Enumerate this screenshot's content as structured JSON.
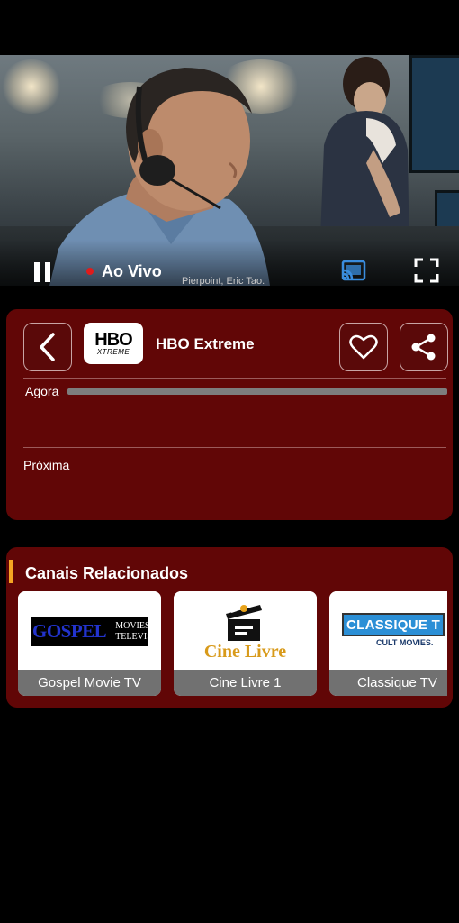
{
  "player": {
    "live_label": "Ao Vivo",
    "subtitle": "Pierpoint, Eric Tao.",
    "icons": {
      "pause": "pause-icon",
      "cast": "cast-icon",
      "fullscreen": "fullscreen-icon"
    },
    "live_color": "#e01b1b"
  },
  "channel": {
    "logo_main": "HBO",
    "logo_sub": "XTREME",
    "name": "HBO Extreme",
    "now_label": "Agora",
    "next_label": "Próxima",
    "icons": {
      "back": "chevron-left-icon",
      "favorite": "heart-icon",
      "share": "share-icon"
    },
    "panel_color": "#610606"
  },
  "related": {
    "title": "Canais Relacionados",
    "accent_color": "#f5a623",
    "items": [
      {
        "name": "Gospel Movie TV",
        "logo_a": "GOSPEL",
        "logo_b": "MOVIES",
        "logo_c": "TELEVISION"
      },
      {
        "name": "Cine Livre 1",
        "logo_a": "Cine Livre"
      },
      {
        "name": "Classique TV",
        "logo_a": "CLASSIQUE T",
        "logo_b": "CULT MOVIES."
      }
    ]
  }
}
